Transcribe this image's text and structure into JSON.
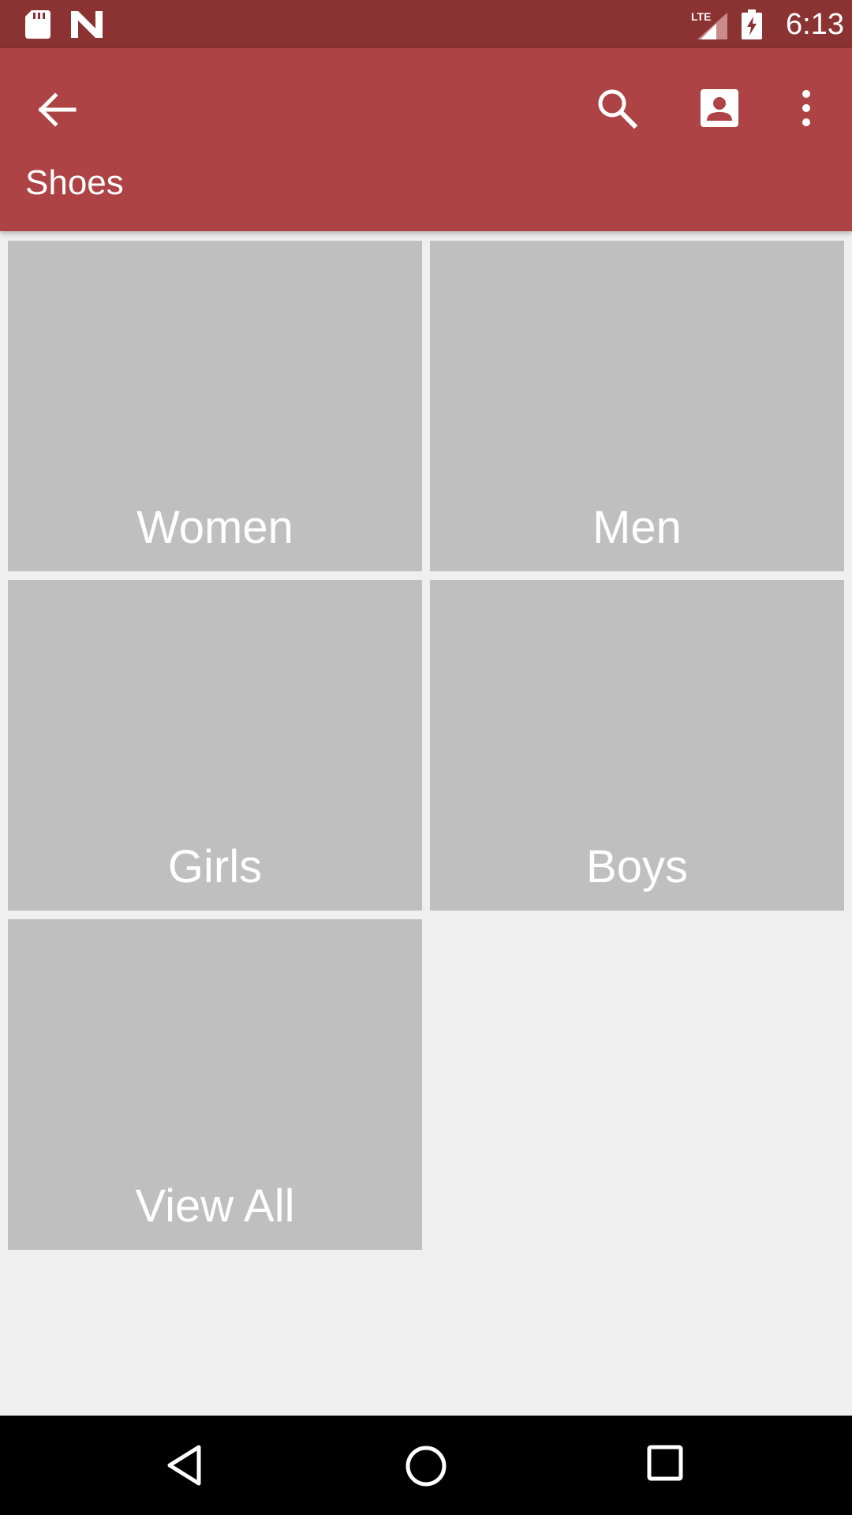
{
  "status_bar": {
    "time": "6:13",
    "network_label": "LTE",
    "icons": [
      "sd-card-icon",
      "n-notification-icon",
      "lte-signal-icon",
      "battery-charging-icon"
    ]
  },
  "app_bar": {
    "title": "Shoes",
    "back_icon": "arrow-back-icon",
    "actions": [
      "search-icon",
      "account-box-icon",
      "more-vert-icon"
    ]
  },
  "categories": [
    {
      "label": "Women"
    },
    {
      "label": "Men"
    },
    {
      "label": "Girls"
    },
    {
      "label": "Boys"
    },
    {
      "label": "View All"
    }
  ],
  "nav_bar": {
    "icons": [
      "nav-back-icon",
      "home-icon",
      "recents-icon"
    ]
  },
  "colors": {
    "status_bar": "#8b3233",
    "app_bar": "#ad4344",
    "tile": "#bfbfbf",
    "background": "#efefef",
    "nav_bar": "#000000"
  }
}
